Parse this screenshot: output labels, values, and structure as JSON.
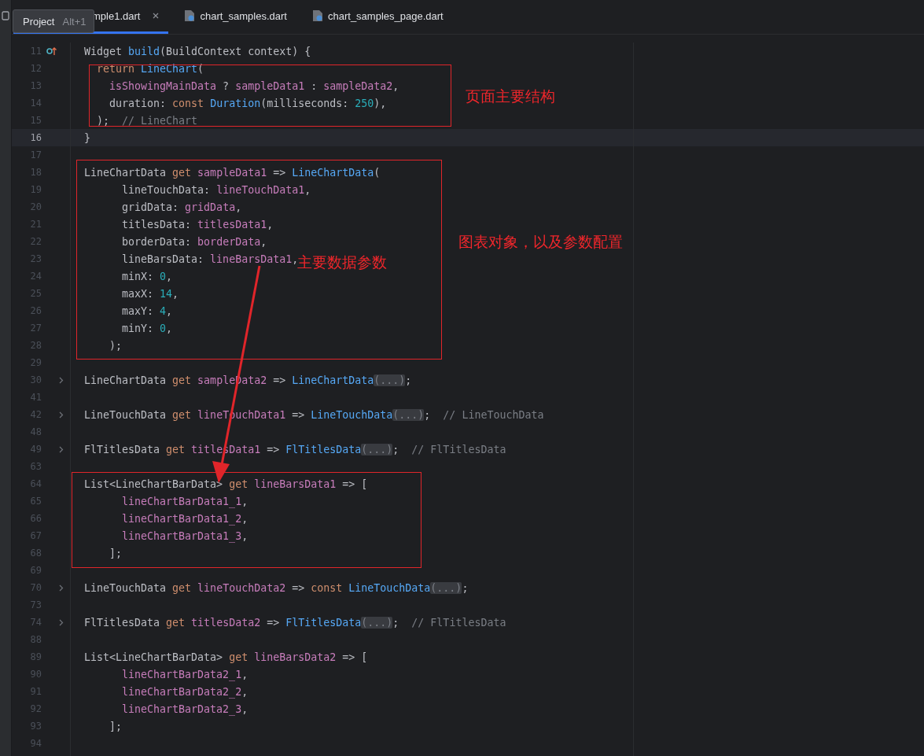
{
  "tabs": [
    {
      "label": "mple1.dart",
      "selected": true,
      "closable": true,
      "icon": false
    },
    {
      "label": "chart_samples.dart",
      "selected": false,
      "closable": false,
      "icon": true
    },
    {
      "label": "chart_samples_page.dart",
      "selected": false,
      "closable": false,
      "icon": true
    }
  ],
  "tooltip": {
    "title": "Project",
    "shortcut": "Alt+1"
  },
  "lines": [
    {
      "number": "11",
      "selected": false,
      "kind": "override",
      "tokens": [
        {
          "text": "Widget ",
          "kind": "plain"
        },
        {
          "text": "build",
          "kind": "fn"
        },
        {
          "text": "(BuildContext context) {",
          "kind": "plain"
        }
      ]
    },
    {
      "number": "12",
      "selected": false,
      "kind": "code",
      "tokens": [
        {
          "text": "  return ",
          "kind": "kw"
        },
        {
          "text": "LineChart",
          "kind": "fn"
        },
        {
          "text": "(",
          "kind": "plain"
        }
      ]
    },
    {
      "number": "13",
      "selected": false,
      "kind": "code",
      "tokens": [
        {
          "text": "    isShowingMainData",
          "kind": "field"
        },
        {
          "text": " ? ",
          "kind": "plain"
        },
        {
          "text": "sampleData1",
          "kind": "field"
        },
        {
          "text": " : ",
          "kind": "plain"
        },
        {
          "text": "sampleData2",
          "kind": "field"
        },
        {
          "text": ",",
          "kind": "plain"
        }
      ]
    },
    {
      "number": "14",
      "selected": false,
      "kind": "code",
      "tokens": [
        {
          "text": "    duration: ",
          "kind": "plain"
        },
        {
          "text": "const ",
          "kind": "kw"
        },
        {
          "text": "Duration",
          "kind": "fn"
        },
        {
          "text": "(milliseconds: ",
          "kind": "plain"
        },
        {
          "text": "250",
          "kind": "num"
        },
        {
          "text": "),",
          "kind": "plain"
        }
      ]
    },
    {
      "number": "15",
      "selected": false,
      "kind": "code",
      "tokens": [
        {
          "text": "  );  ",
          "kind": "plain"
        },
        {
          "text": "// LineChart",
          "kind": "comment"
        }
      ]
    },
    {
      "number": "16",
      "selected": true,
      "kind": "code",
      "tokens": [
        {
          "text": "}",
          "kind": "plain"
        }
      ]
    },
    {
      "number": "17",
      "selected": false,
      "kind": "code"
    },
    {
      "number": "18",
      "selected": false,
      "kind": "code",
      "tokens": [
        {
          "text": "LineChartData ",
          "kind": "plain"
        },
        {
          "text": "get ",
          "kind": "kw"
        },
        {
          "text": "sampleData1",
          "kind": "field"
        },
        {
          "text": " => ",
          "kind": "plain"
        },
        {
          "text": "LineChartData",
          "kind": "fn"
        },
        {
          "text": "(",
          "kind": "plain"
        }
      ]
    },
    {
      "number": "19",
      "selected": false,
      "kind": "code",
      "tokens": [
        {
          "text": "      lineTouchData: ",
          "kind": "plain"
        },
        {
          "text": "lineTouchData1",
          "kind": "field"
        },
        {
          "text": ",",
          "kind": "plain"
        }
      ]
    },
    {
      "number": "20",
      "selected": false,
      "kind": "code",
      "tokens": [
        {
          "text": "      gridData: ",
          "kind": "plain"
        },
        {
          "text": "gridData",
          "kind": "field"
        },
        {
          "text": ",",
          "kind": "plain"
        }
      ]
    },
    {
      "number": "21",
      "selected": false,
      "kind": "code",
      "tokens": [
        {
          "text": "      titlesData: ",
          "kind": "plain"
        },
        {
          "text": "titlesData1",
          "kind": "field"
        },
        {
          "text": ",",
          "kind": "plain"
        }
      ]
    },
    {
      "number": "22",
      "selected": false,
      "kind": "code",
      "tokens": [
        {
          "text": "      borderData: ",
          "kind": "plain"
        },
        {
          "text": "borderData",
          "kind": "field"
        },
        {
          "text": ",",
          "kind": "plain"
        }
      ]
    },
    {
      "number": "23",
      "selected": false,
      "kind": "code",
      "tokens": [
        {
          "text": "      lineBarsData: ",
          "kind": "plain"
        },
        {
          "text": "lineBarsData1",
          "kind": "field"
        },
        {
          "text": ",",
          "kind": "plain"
        }
      ]
    },
    {
      "number": "24",
      "selected": false,
      "kind": "code",
      "tokens": [
        {
          "text": "      minX: ",
          "kind": "plain"
        },
        {
          "text": "0",
          "kind": "num"
        },
        {
          "text": ",",
          "kind": "plain"
        }
      ]
    },
    {
      "number": "25",
      "selected": false,
      "kind": "code",
      "tokens": [
        {
          "text": "      maxX: ",
          "kind": "plain"
        },
        {
          "text": "14",
          "kind": "num"
        },
        {
          "text": ",",
          "kind": "plain"
        }
      ]
    },
    {
      "number": "26",
      "selected": false,
      "kind": "code",
      "tokens": [
        {
          "text": "      maxY: ",
          "kind": "plain"
        },
        {
          "text": "4",
          "kind": "num"
        },
        {
          "text": ",",
          "kind": "plain"
        }
      ]
    },
    {
      "number": "27",
      "selected": false,
      "kind": "code",
      "tokens": [
        {
          "text": "      minY: ",
          "kind": "plain"
        },
        {
          "text": "0",
          "kind": "num"
        },
        {
          "text": ",",
          "kind": "plain"
        }
      ]
    },
    {
      "number": "28",
      "selected": false,
      "kind": "code",
      "tokens": [
        {
          "text": "    );",
          "kind": "plain"
        }
      ]
    },
    {
      "number": "29",
      "selected": false,
      "kind": "code"
    },
    {
      "number": "30",
      "selected": false,
      "kind": "fold",
      "tokens": [
        {
          "text": "LineChartData ",
          "kind": "plain"
        },
        {
          "text": "get ",
          "kind": "kw"
        },
        {
          "text": "sampleData2",
          "kind": "field"
        },
        {
          "text": " => ",
          "kind": "plain"
        },
        {
          "text": "LineChartData",
          "kind": "fn"
        },
        {
          "text": "(...)",
          "kind": "folded"
        },
        {
          "text": ";",
          "kind": "plain"
        }
      ]
    },
    {
      "number": "41",
      "selected": false,
      "kind": "code"
    },
    {
      "number": "42",
      "selected": false,
      "kind": "fold",
      "tokens": [
        {
          "text": "LineTouchData ",
          "kind": "plain"
        },
        {
          "text": "get ",
          "kind": "kw"
        },
        {
          "text": "lineTouchData1",
          "kind": "field"
        },
        {
          "text": " => ",
          "kind": "plain"
        },
        {
          "text": "LineTouchData",
          "kind": "fn"
        },
        {
          "text": "(...)",
          "kind": "folded"
        },
        {
          "text": ";  ",
          "kind": "plain"
        },
        {
          "text": "// LineTouchData",
          "kind": "comment"
        }
      ]
    },
    {
      "number": "48",
      "selected": false,
      "kind": "code"
    },
    {
      "number": "49",
      "selected": false,
      "kind": "fold",
      "tokens": [
        {
          "text": "FlTitlesData ",
          "kind": "plain"
        },
        {
          "text": "get ",
          "kind": "kw"
        },
        {
          "text": "titlesData1",
          "kind": "field"
        },
        {
          "text": " => ",
          "kind": "plain"
        },
        {
          "text": "FlTitlesData",
          "kind": "fn"
        },
        {
          "text": "(...)",
          "kind": "folded"
        },
        {
          "text": ";  ",
          "kind": "plain"
        },
        {
          "text": "// FlTitlesData",
          "kind": "comment"
        }
      ]
    },
    {
      "number": "63",
      "selected": false,
      "kind": "code"
    },
    {
      "number": "64",
      "selected": false,
      "kind": "code",
      "tokens": [
        {
          "text": "List<LineChartBarData> ",
          "kind": "plain"
        },
        {
          "text": "get ",
          "kind": "kw"
        },
        {
          "text": "lineBarsData1",
          "kind": "field"
        },
        {
          "text": " => [",
          "kind": "plain"
        }
      ]
    },
    {
      "number": "65",
      "selected": false,
      "kind": "code",
      "tokens": [
        {
          "text": "      lineChartBarData1_1",
          "kind": "field"
        },
        {
          "text": ",",
          "kind": "plain"
        }
      ]
    },
    {
      "number": "66",
      "selected": false,
      "kind": "code",
      "tokens": [
        {
          "text": "      lineChartBarData1_2",
          "kind": "field"
        },
        {
          "text": ",",
          "kind": "plain"
        }
      ]
    },
    {
      "number": "67",
      "selected": false,
      "kind": "code",
      "tokens": [
        {
          "text": "      lineChartBarData1_3",
          "kind": "field"
        },
        {
          "text": ",",
          "kind": "plain"
        }
      ]
    },
    {
      "number": "68",
      "selected": false,
      "kind": "code",
      "tokens": [
        {
          "text": "    ];",
          "kind": "plain"
        }
      ]
    },
    {
      "number": "69",
      "selected": false,
      "kind": "code"
    },
    {
      "number": "70",
      "selected": false,
      "kind": "fold",
      "tokens": [
        {
          "text": "LineTouchData ",
          "kind": "plain"
        },
        {
          "text": "get ",
          "kind": "kw"
        },
        {
          "text": "lineTouchData2",
          "kind": "field"
        },
        {
          "text": " => ",
          "kind": "plain"
        },
        {
          "text": "const ",
          "kind": "kw"
        },
        {
          "text": "LineTouchData",
          "kind": "fn"
        },
        {
          "text": "(...)",
          "kind": "folded"
        },
        {
          "text": ";",
          "kind": "plain"
        }
      ]
    },
    {
      "number": "73",
      "selected": false,
      "kind": "code"
    },
    {
      "number": "74",
      "selected": false,
      "kind": "fold",
      "tokens": [
        {
          "text": "FlTitlesData ",
          "kind": "plain"
        },
        {
          "text": "get ",
          "kind": "kw"
        },
        {
          "text": "titlesData2",
          "kind": "field"
        },
        {
          "text": " => ",
          "kind": "plain"
        },
        {
          "text": "FlTitlesData",
          "kind": "fn"
        },
        {
          "text": "(...)",
          "kind": "folded"
        },
        {
          "text": ";  ",
          "kind": "plain"
        },
        {
          "text": "// FlTitlesData",
          "kind": "comment"
        }
      ]
    },
    {
      "number": "88",
      "selected": false,
      "kind": "code"
    },
    {
      "number": "89",
      "selected": false,
      "kind": "code",
      "tokens": [
        {
          "text": "List<LineChartBarData> ",
          "kind": "plain"
        },
        {
          "text": "get ",
          "kind": "kw"
        },
        {
          "text": "lineBarsData2",
          "kind": "field"
        },
        {
          "text": " => [",
          "kind": "plain"
        }
      ]
    },
    {
      "number": "90",
      "selected": false,
      "kind": "code",
      "tokens": [
        {
          "text": "      lineChartBarData2_1",
          "kind": "field"
        },
        {
          "text": ",",
          "kind": "plain"
        }
      ]
    },
    {
      "number": "91",
      "selected": false,
      "kind": "code",
      "tokens": [
        {
          "text": "      lineChartBarData2_2",
          "kind": "field"
        },
        {
          "text": ",",
          "kind": "plain"
        }
      ]
    },
    {
      "number": "92",
      "selected": false,
      "kind": "code",
      "tokens": [
        {
          "text": "      lineChartBarData2_3",
          "kind": "field"
        },
        {
          "text": ",",
          "kind": "plain"
        }
      ]
    },
    {
      "number": "93",
      "selected": false,
      "kind": "code",
      "tokens": [
        {
          "text": "    ];",
          "kind": "plain"
        }
      ]
    },
    {
      "number": "94",
      "selected": false,
      "kind": "code"
    }
  ],
  "notes": [
    {
      "text": "页面主要结构"
    },
    {
      "text": "图表对象，以及参数配置"
    },
    {
      "text": "主要数据参数"
    }
  ]
}
